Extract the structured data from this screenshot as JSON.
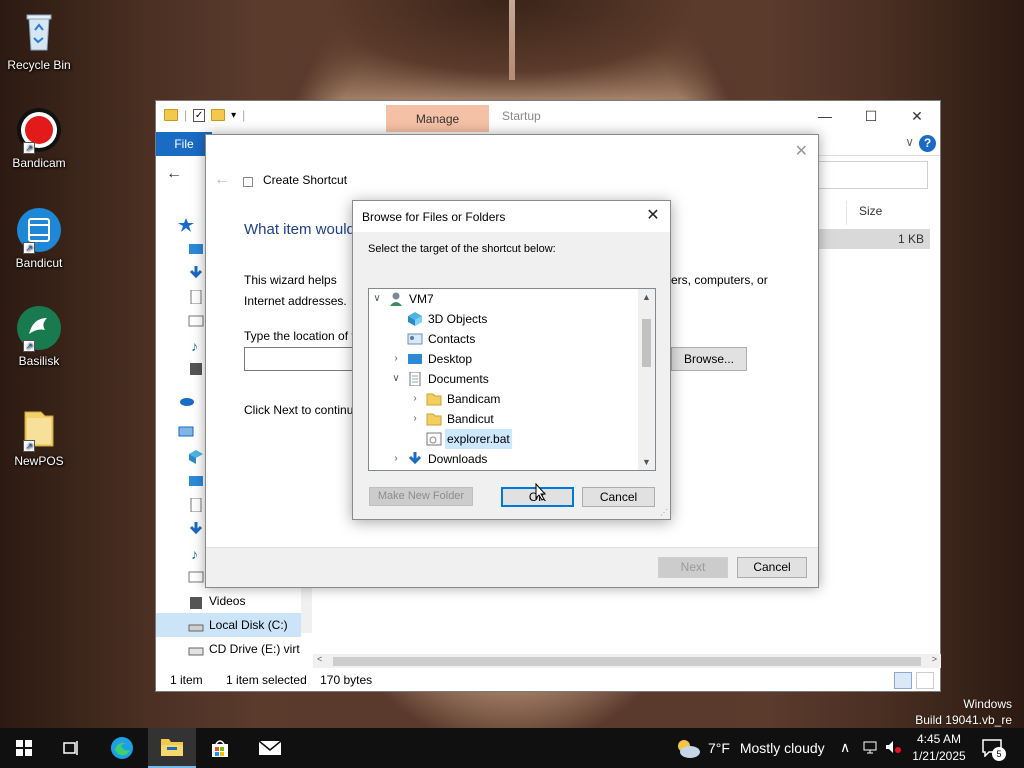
{
  "desktop": {
    "icons": [
      {
        "label": "Recycle Bin",
        "icon": "recycle-bin-icon"
      },
      {
        "label": "Bandicam",
        "icon": "bandicam-icon"
      },
      {
        "label": "Bandicut",
        "icon": "bandicut-icon"
      },
      {
        "label": "Basilisk",
        "icon": "basilisk-icon"
      },
      {
        "label": "NewPOS",
        "icon": "folder-icon"
      }
    ],
    "watermark": {
      "line1": "Windows",
      "line2": "Build 19041.vb_re"
    }
  },
  "explorer": {
    "ribbon": {
      "manage_tab": "Manage",
      "startup_tab": "Startup",
      "file_tab": "File"
    },
    "window_controls": {
      "minimize": "—",
      "maximize": "☐",
      "close": "✕"
    },
    "columns": {
      "size": "Size"
    },
    "selected_row": {
      "size": "1 KB"
    },
    "nav_items": [
      {
        "label": "Videos",
        "icon": "videos-icon"
      },
      {
        "label": "Local Disk (C:)",
        "icon": "local-disk-icon",
        "selected": true
      },
      {
        "label": "CD Drive (E:) virt",
        "icon": "cd-drive-icon"
      }
    ],
    "status": {
      "items": "1 item",
      "selected": "1 item selected",
      "size": "170 bytes"
    }
  },
  "wizard": {
    "title": "Create Shortcut",
    "heading": "What item would you like to create a shortcut for?",
    "intro_left": "This wizard helps you",
    "intro_right": "ers, computers, or",
    "intro_line2": "Internet addresses.",
    "location_label": "Type the location of the item:",
    "location_value": "",
    "browse_label": "Browse...",
    "continue_text": "Click Next to continue.",
    "next_label": "Next",
    "cancel_label": "Cancel"
  },
  "browse": {
    "title": "Browse for Files or Folders",
    "instruction": "Select the target of the shortcut below:",
    "tree": [
      {
        "label": "VM7",
        "icon": "user-icon",
        "expander": "open"
      },
      {
        "label": "3D Objects",
        "icon": "3d-objects-icon",
        "expander": ""
      },
      {
        "label": "Contacts",
        "icon": "contacts-icon",
        "expander": ""
      },
      {
        "label": "Desktop",
        "icon": "desktop-icon",
        "expander": "closed"
      },
      {
        "label": "Documents",
        "icon": "documents-icon",
        "expander": "open"
      },
      {
        "label": "Bandicam",
        "icon": "folder-icon",
        "expander": "closed"
      },
      {
        "label": "Bandicut",
        "icon": "folder-icon",
        "expander": "closed"
      },
      {
        "label": "explorer.bat",
        "icon": "batch-file-icon",
        "expander": "",
        "selected": true
      },
      {
        "label": "Downloads",
        "icon": "downloads-icon",
        "expander": "closed"
      }
    ],
    "new_folder_label": "Make New Folder",
    "ok_label": "OK",
    "cancel_label": "Cancel"
  },
  "taskbar": {
    "weather": {
      "temp": "7°F",
      "condition": "Mostly cloudy"
    },
    "clock": {
      "time": "4:45 AM",
      "date": "1/21/2025"
    },
    "notifications": "5",
    "apps": [
      "start-icon",
      "task-view-icon",
      "edge-icon",
      "file-explorer-icon",
      "store-icon",
      "mail-icon"
    ]
  }
}
